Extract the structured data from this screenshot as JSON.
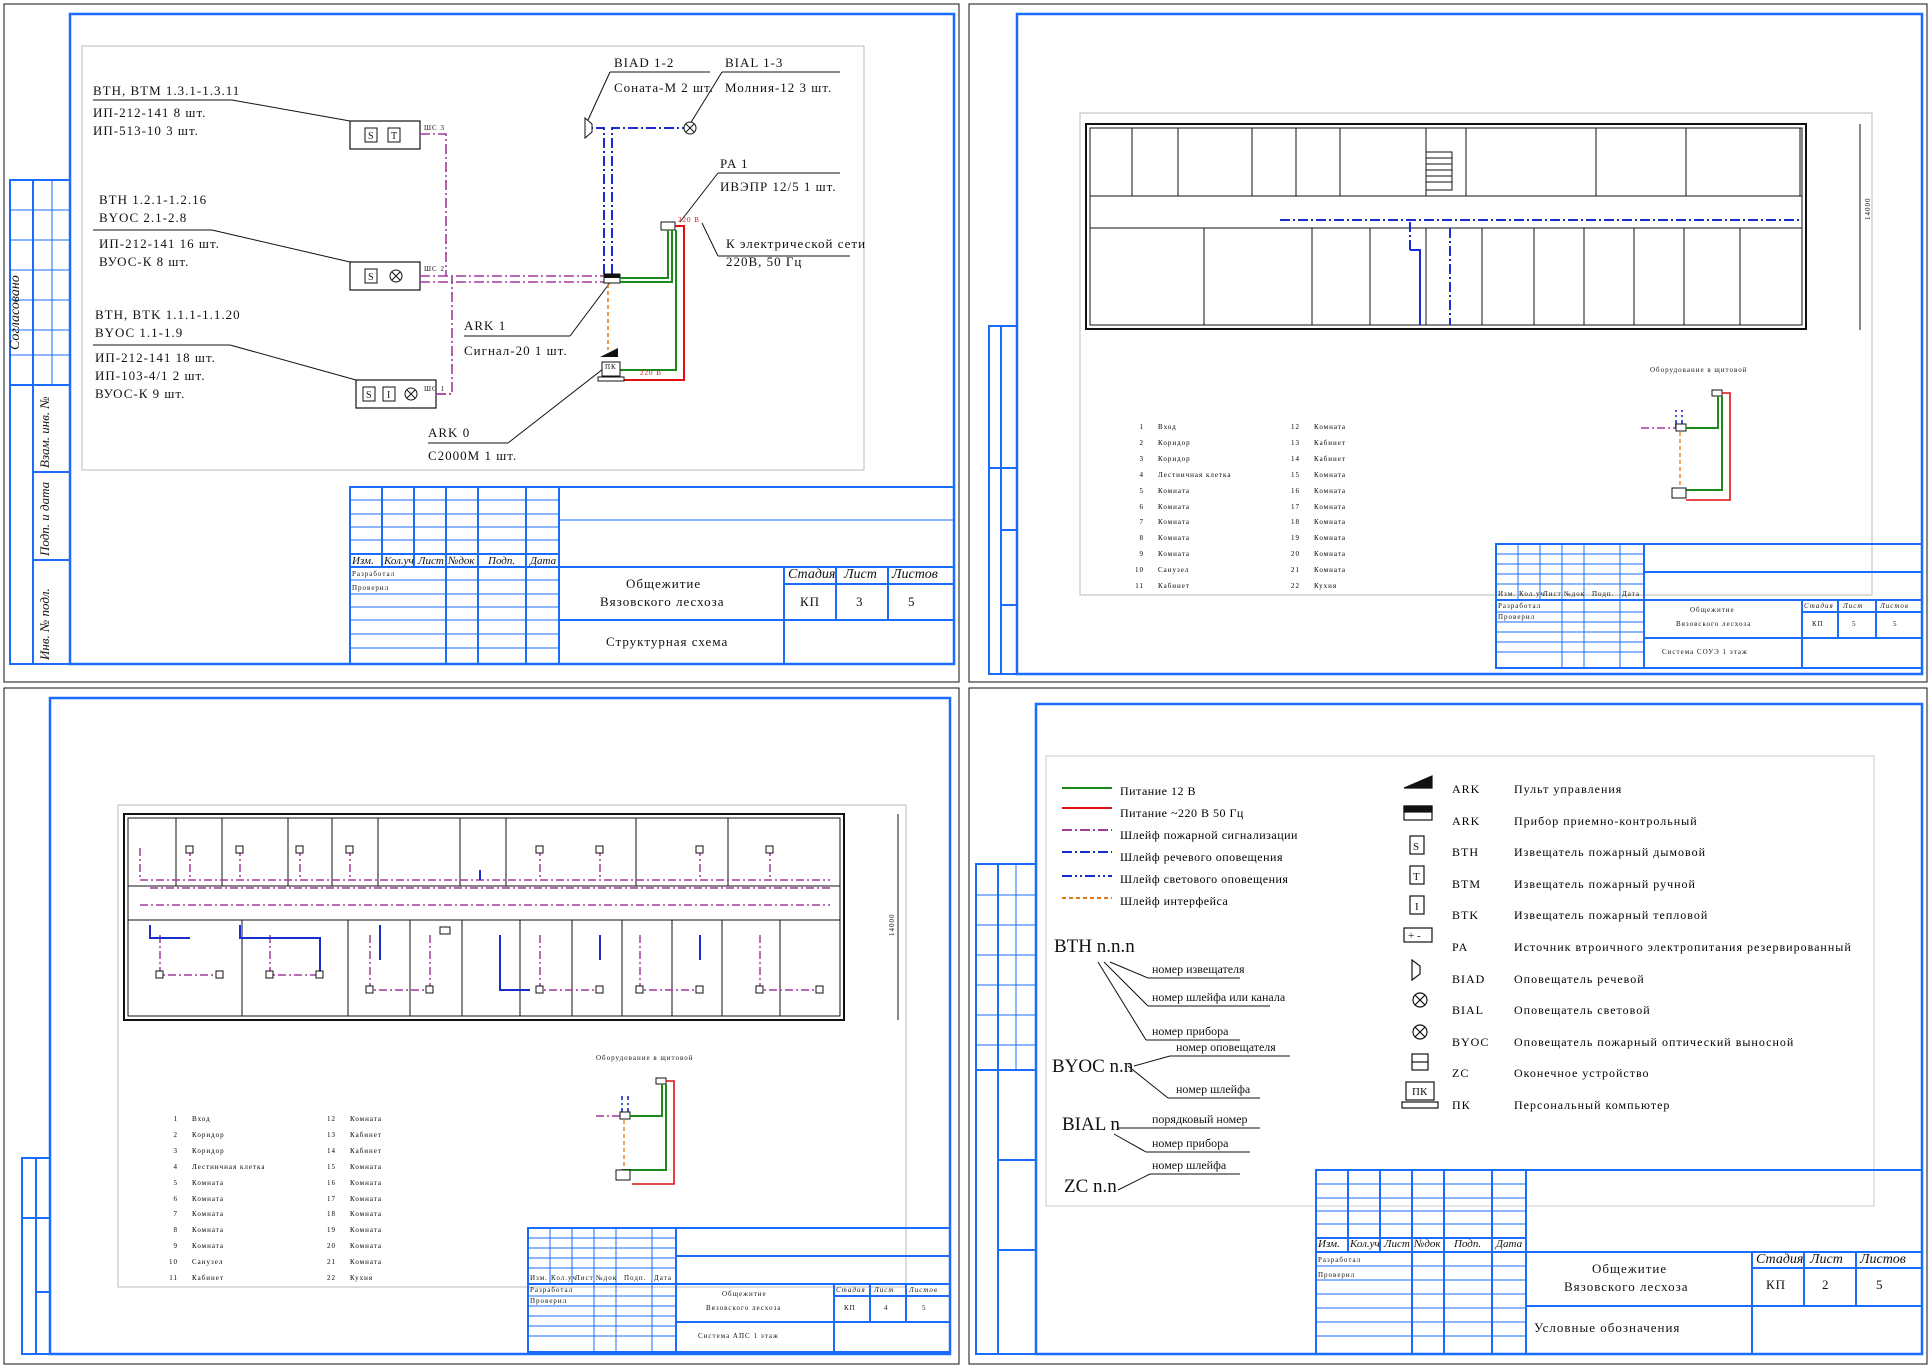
{
  "sheets": {
    "s1": {
      "stamp": {
        "headers": [
          "Изм.",
          "Кол.уч",
          "Лист",
          "№док",
          "Подп.",
          "Дата"
        ],
        "developed": "Разработал",
        "checked": "Проверил",
        "title_line1": "Общежитие",
        "title_line2": "Вязовского лесхоза",
        "stage_label": "Стадия",
        "sheet_label": "Лист",
        "sheets_label": "Листов",
        "stage": "КП",
        "sheet": "3",
        "sheets": "5",
        "doc_title": "Структурная схема"
      },
      "side": {
        "agreed": "Согласовано",
        "inv_mark": "Взам. инв. №",
        "sign_date": "Подп. и дата",
        "inv_orig": "Инв. № подл."
      },
      "diagram": {
        "biad_title": "BIAD 1-2",
        "biad_val": "Соната-М  2 шт.",
        "bial_title": "BIAL 1-3",
        "bial_val": "Молния-12  3 шт.",
        "pa_title": "PA 1",
        "pa_val": "ИВЭПР 12/5 1 шт.",
        "net_line1": "К электрической сети",
        "net_line2": "220В, 50 Гц",
        "g1_title": "BTH, BTM 1.3.1-1.3.11",
        "g1_l1": "ИП-212-141  8 шт.",
        "g1_l2": "ИП-513-10   3 шт.",
        "g2_title": "BTH 1.2.1-1.2.16",
        "g2_title2": "BYOC 2.1-2.8",
        "g2_l1": "ИП-212-141  16 шт.",
        "g2_l2": "ВУОС-К  8 шт.",
        "g3_title": "BTH, BTK 1.1.1-1.1.20",
        "g3_title2": "BYOC 1.1-1.9",
        "g3_l1": "ИП-212-141  18 шт.",
        "g3_l2": "ИП-103-4/1  2 шт.",
        "g3_l3": "ВУОС-К  9 шт.",
        "ark1_title": "ARK 1",
        "ark1_val": "Сигнал-20  1 шт.",
        "ark0_title": "ARK 0",
        "ark0_val": "С2000М 1 шт.",
        "v220a": "220 В",
        "v220b": "220 В",
        "pk": "ПК",
        "shs3": "ШС 3",
        "shs2": "ШС 2",
        "shs1": "ШС 1"
      }
    },
    "s2": {
      "stamp": {
        "headers": [
          "Изм.",
          "Кол.уч",
          "Лист",
          "№док",
          "Подп.",
          "Дата"
        ],
        "developed": "Разработал",
        "checked": "Проверил",
        "title_line1": "Общежитие",
        "title_line2": "Вязовского лесхоза",
        "stage_label": "Стадия",
        "sheet_label": "Лист",
        "sheets_label": "Листов",
        "stage": "КП",
        "sheet": "5",
        "sheets": "5",
        "doc_title": "Система СОУЭ 1 этаж"
      },
      "equip_title": "Оборудование в щитовой",
      "dim": "14000",
      "rooms_left": [
        [
          "1",
          "Вход"
        ],
        [
          "2",
          "Коридор"
        ],
        [
          "3",
          "Коридор"
        ],
        [
          "4",
          "Лестничная клетка"
        ],
        [
          "5",
          "Комната"
        ],
        [
          "6",
          "Комната"
        ],
        [
          "7",
          "Комната"
        ],
        [
          "8",
          "Комната"
        ],
        [
          "9",
          "Комната"
        ],
        [
          "10",
          "Санузел"
        ],
        [
          "11",
          "Кабинет"
        ]
      ],
      "rooms_right": [
        [
          "12",
          "Комната"
        ],
        [
          "13",
          "Кабинет"
        ],
        [
          "14",
          "Кабинет"
        ],
        [
          "15",
          "Комната"
        ],
        [
          "16",
          "Комната"
        ],
        [
          "17",
          "Комната"
        ],
        [
          "18",
          "Комната"
        ],
        [
          "19",
          "Комната"
        ],
        [
          "20",
          "Комната"
        ],
        [
          "21",
          "Комната"
        ],
        [
          "22",
          "Кухня"
        ]
      ]
    },
    "s3": {
      "stamp": {
        "headers": [
          "Изм.",
          "Кол.уч",
          "Лист",
          "№док",
          "Подп.",
          "Дата"
        ],
        "developed": "Разработал",
        "checked": "Проверил",
        "title_line1": "Общежитие",
        "title_line2": "Вязовского лесхоза",
        "stage_label": "Стадия",
        "sheet_label": "Лист",
        "sheets_label": "Листов",
        "stage": "КП",
        "sheet": "4",
        "sheets": "5",
        "doc_title": "Система АПС 1 этаж"
      },
      "equip_title": "Оборудование в щитовой",
      "dim": "14000"
    },
    "s4": {
      "stamp": {
        "headers": [
          "Изм.",
          "Кол.уч",
          "Лист",
          "№док",
          "Подп.",
          "Дата"
        ],
        "developed": "Разработал",
        "checked": "Проверил",
        "title_line1": "Общежитие",
        "title_line2": "Вязовского лесхоза",
        "stage_label": "Стадия",
        "sheet_label": "Лист",
        "sheets_label": "Листов",
        "stage": "КП",
        "sheet": "2",
        "sheets": "5",
        "doc_title": "Условные обозначения"
      },
      "lines_legend": [
        {
          "label": "Питание 12 В",
          "color": "#1a8a1a",
          "dash": ""
        },
        {
          "label": "Питание ~220 В 50 Гц",
          "color": "#e01010",
          "dash": ""
        },
        {
          "label": "Шлейф пожарной сигнализации",
          "color": "#a03c9c",
          "dash": "10 3 2 3"
        },
        {
          "label": "Шлейф речевого оповещения",
          "color": "#1a2ccc",
          "dash": "10 3 2 3"
        },
        {
          "label": "Шлейф светового оповещения",
          "color": "#1a2ccc",
          "dash": "10 3 2 3 2 3"
        },
        {
          "label": "Шлейф интерфейса",
          "color": "#e07818",
          "dash": "4 3"
        }
      ],
      "symbols": [
        {
          "code": "ARK",
          "desc": "Пульт управления"
        },
        {
          "code": "ARK",
          "desc": "Прибор приемно-контрольный"
        },
        {
          "code": "BTH",
          "desc": "Извещатель пожарный дымовой"
        },
        {
          "code": "BTM",
          "desc": "Извещатель пожарный ручной"
        },
        {
          "code": "BTK",
          "desc": "Извещатель пожарный тепловой"
        },
        {
          "code": "PA",
          "desc": "Источник втроичного электропитания резервированный"
        },
        {
          "code": "BIAD",
          "desc": "Оповещатель речевой"
        },
        {
          "code": "BIAL",
          "desc": "Оповещатель световой"
        },
        {
          "code": "BYOC",
          "desc": "Оповещатель пожарный оптический выносной"
        },
        {
          "code": "ZC",
          "desc": "Оконечное устройство"
        },
        {
          "code": "ПК",
          "desc": "Персональный компьютер"
        }
      ],
      "notation": {
        "bth": "BTH n.n.n",
        "bth_1": "номер извещателя",
        "bth_2": "номер шлейфа или канала",
        "bth_3": "номер прибора",
        "byoc": "BYOC n.n",
        "byoc_1": "номер оповещателя",
        "byoc_2": "номер шлейфа",
        "bial": "BIAL n",
        "bial_1": "порядковый номер",
        "bial_2": "номер прибора",
        "zc": "ZC n.n",
        "zc_1": "номер шлейфа"
      }
    }
  }
}
